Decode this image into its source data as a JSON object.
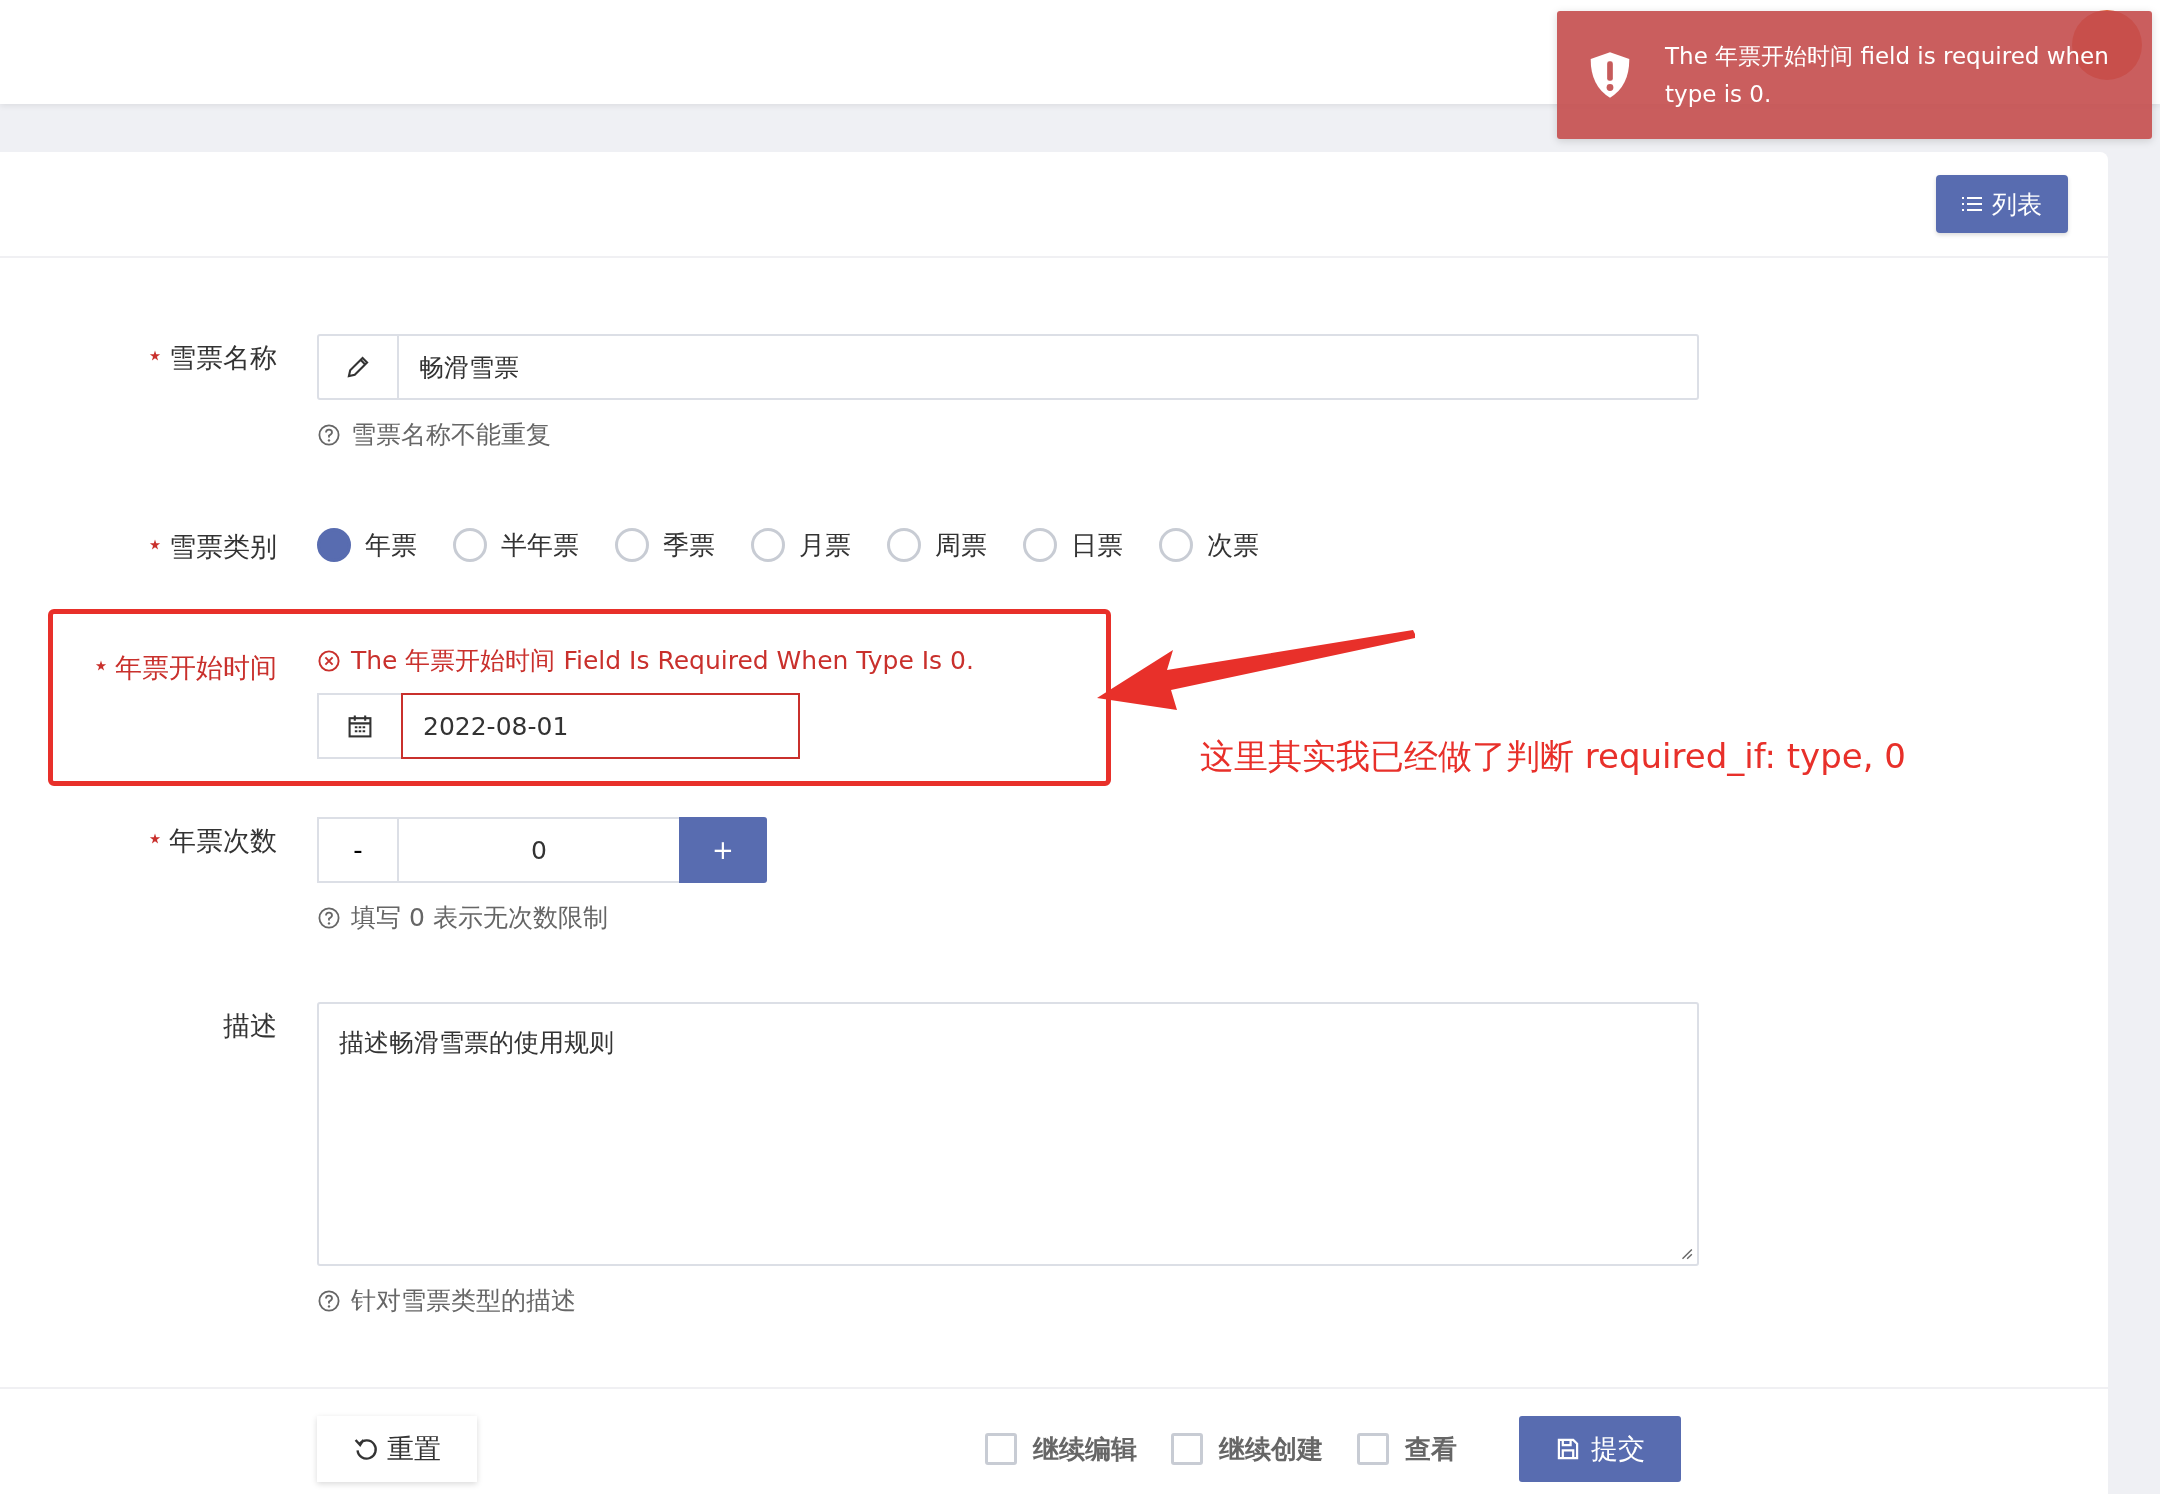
{
  "toast": {
    "message": "The 年票开始时间 field is required when type is 0."
  },
  "card": {
    "list_button": "列表"
  },
  "fields": [
    {
      "kind": "text",
      "label": "雪票名称",
      "required": true,
      "value": "畅滑雪票",
      "help": "雪票名称不能重复"
    },
    {
      "kind": "radio",
      "label": "雪票类别",
      "required": true,
      "options": [
        {
          "label": "年票",
          "selected": true
        },
        {
          "label": "半年票",
          "selected": false
        },
        {
          "label": "季票",
          "selected": false
        },
        {
          "label": "月票",
          "selected": false
        },
        {
          "label": "周票",
          "selected": false
        },
        {
          "label": "日票",
          "selected": false
        },
        {
          "label": "次票",
          "selected": false
        }
      ]
    },
    {
      "kind": "date",
      "label": "年票开始时间",
      "required": true,
      "highlighted": true,
      "error": "The 年票开始时间 Field Is Required When Type Is 0.",
      "value": "2022-08-01"
    },
    {
      "kind": "counter",
      "label": "年票次数",
      "required": true,
      "minus": "-",
      "value": "0",
      "plus": "+",
      "help": "填写 0 表示无次数限制"
    },
    {
      "kind": "textarea",
      "label": "描述",
      "required": false,
      "value": "描述畅滑雪票的使用规则",
      "help": "针对雪票类型的描述"
    }
  ],
  "annotation": {
    "text": "这里其实我已经做了判断 required_if: type, 0"
  },
  "footer": {
    "reset": "重置",
    "options": [
      {
        "label": "继续编辑",
        "checked": false
      },
      {
        "label": "继续创建",
        "checked": false
      },
      {
        "label": "查看",
        "checked": false
      }
    ],
    "submit": "提交"
  }
}
